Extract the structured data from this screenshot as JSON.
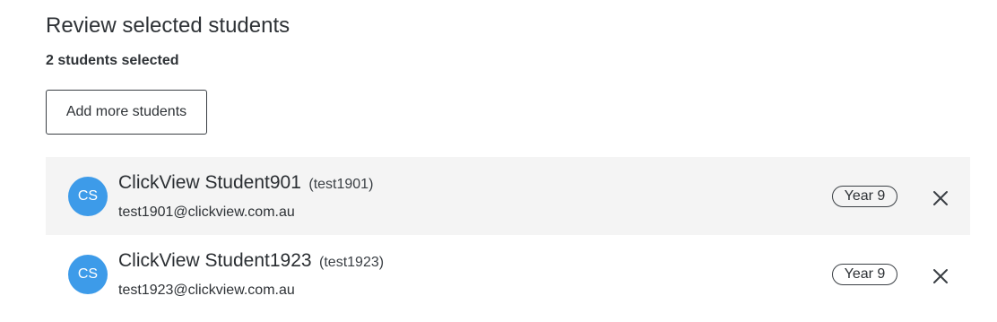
{
  "header": {
    "title": "Review selected students",
    "selected_count": "2 students selected"
  },
  "actions": {
    "add_more_label": "Add more students"
  },
  "students": [
    {
      "initials": "CS",
      "name": "ClickView Student901",
      "username": "(test1901)",
      "email": "test1901@clickview.com.au",
      "year": "Year 9",
      "remove_icon": "close-icon"
    },
    {
      "initials": "CS",
      "name": "ClickView Student1923",
      "username": "(test1923)",
      "email": "test1923@clickview.com.au",
      "year": "Year 9",
      "remove_icon": "close-icon"
    }
  ],
  "colors": {
    "avatar_background": "#3d9be9",
    "shaded_row_background": "#f4f4f4",
    "text": "#2e3236"
  }
}
